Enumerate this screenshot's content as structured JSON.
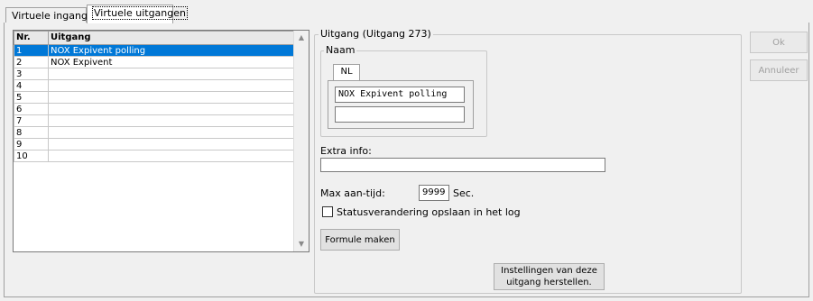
{
  "tabs": [
    {
      "label": "Virtuele ingangen"
    },
    {
      "label": "Virtuele uitgangen"
    }
  ],
  "grid": {
    "headers": {
      "nr": "Nr.",
      "uitgang": "Uitgang"
    },
    "rows": [
      {
        "nr": "1",
        "name": "NOX Expivent polling"
      },
      {
        "nr": "2",
        "name": "NOX Expivent"
      },
      {
        "nr": "3",
        "name": ""
      },
      {
        "nr": "4",
        "name": ""
      },
      {
        "nr": "5",
        "name": ""
      },
      {
        "nr": "6",
        "name": ""
      },
      {
        "nr": "7",
        "name": ""
      },
      {
        "nr": "8",
        "name": ""
      },
      {
        "nr": "9",
        "name": ""
      },
      {
        "nr": "10",
        "name": ""
      }
    ],
    "selected_index": 0
  },
  "detail": {
    "group_title": "Uitgang (Uitgang 273)",
    "naam_group_title": "Naam",
    "language_tab": "NL",
    "naam_value": "NOX Expivent polling",
    "naam_value2": "",
    "extra_info_label": "Extra info:",
    "extra_info_value": "",
    "max_label": "Max aan-tijd:",
    "max_value": "9999",
    "max_unit": "Sec.",
    "status_checkbox_label": "Statusverandering opslaan in het log",
    "status_checked": false,
    "formule_button": "Formule maken",
    "reset_button_line1": "Instellingen van deze",
    "reset_button_line2": "uitgang herstellen."
  },
  "buttons": {
    "ok": "Ok",
    "cancel": "Annuleer"
  }
}
